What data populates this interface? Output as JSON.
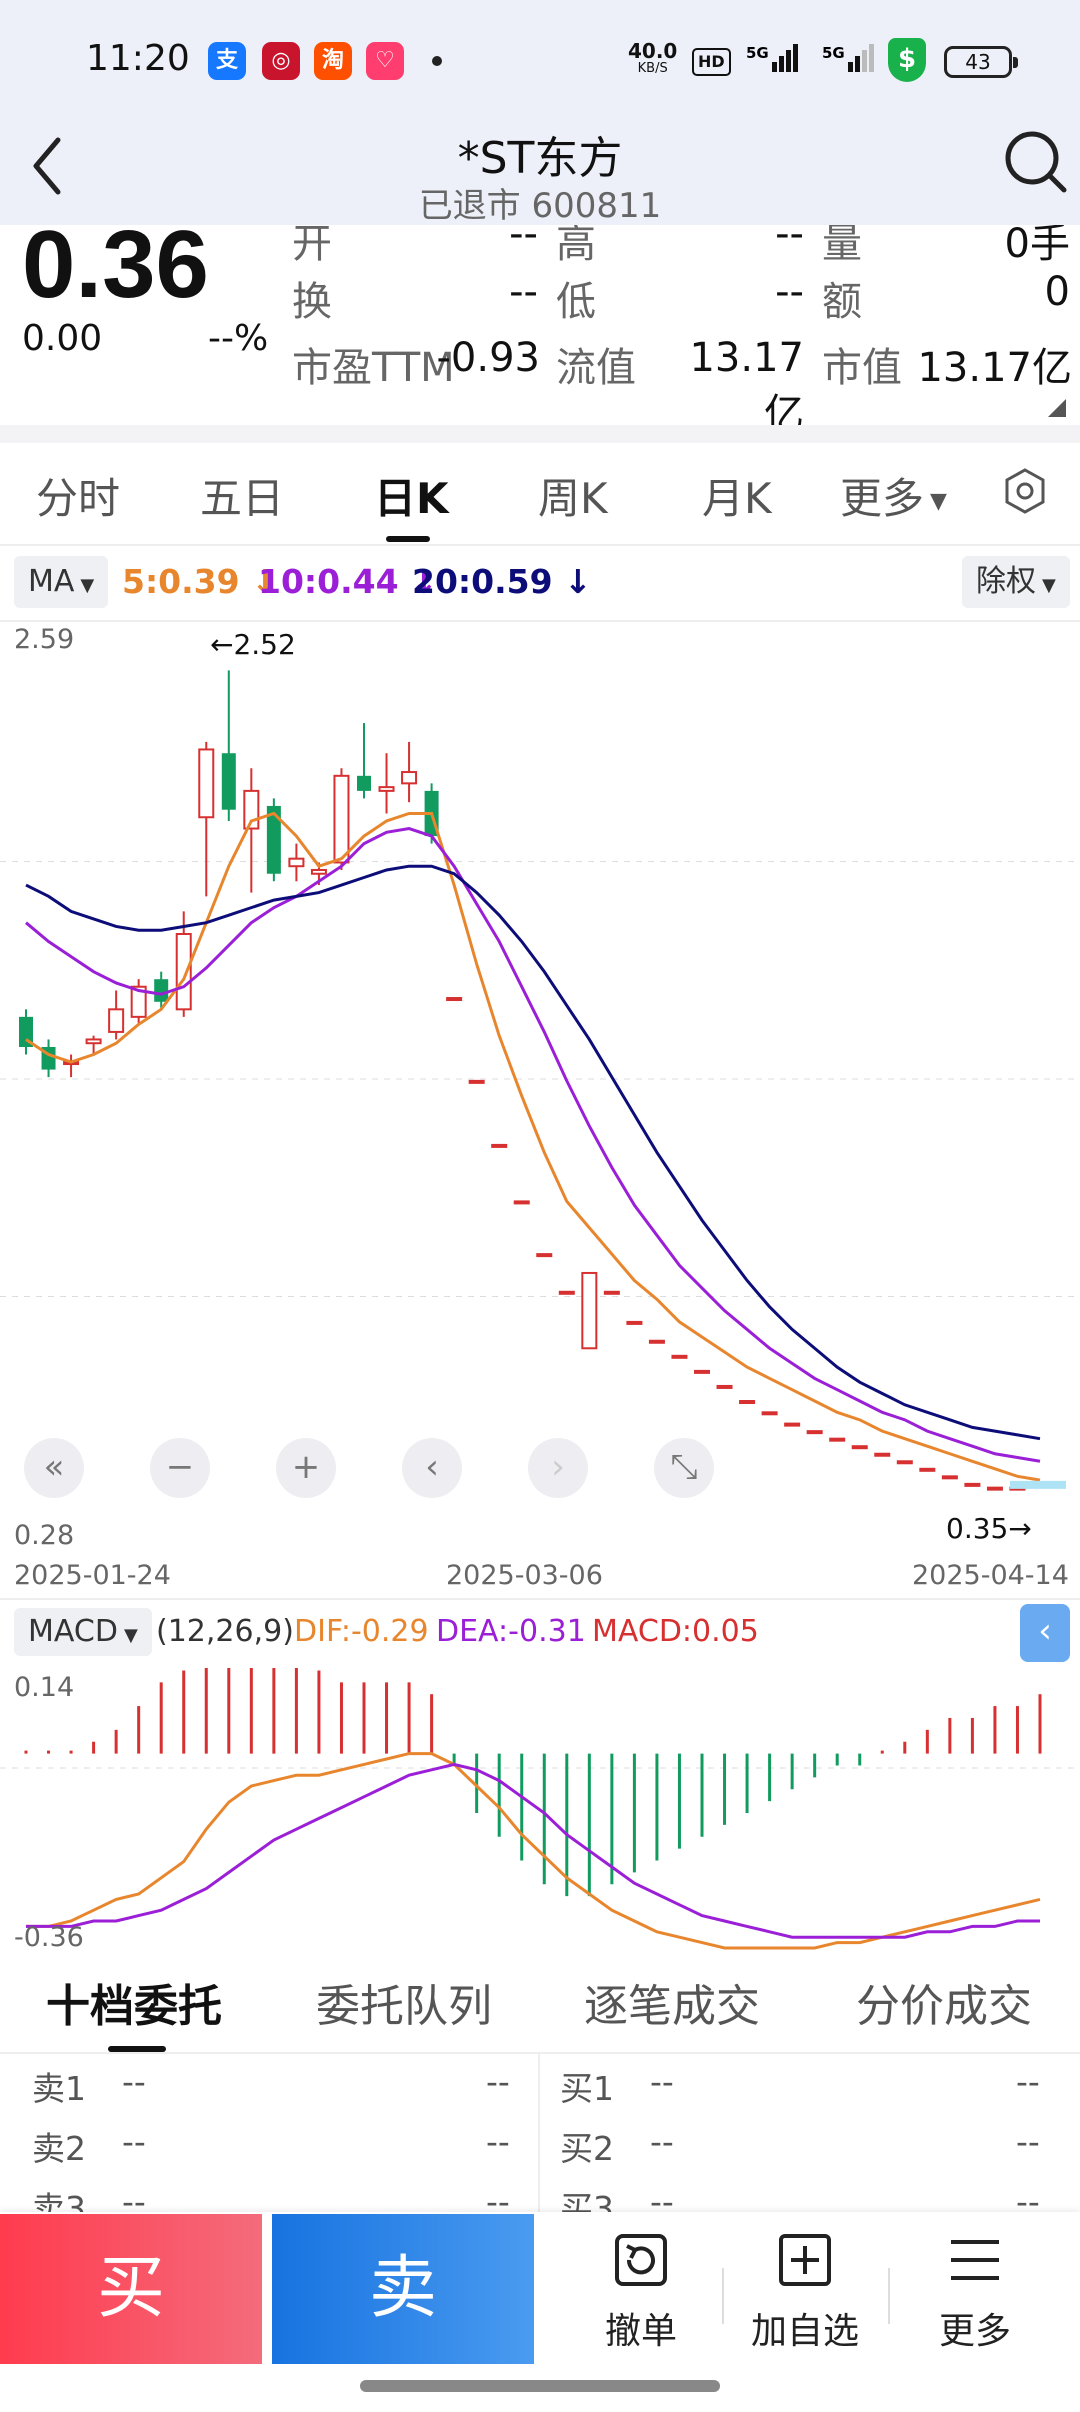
{
  "status_bar": {
    "time": "11:20",
    "net_speed": "40.0",
    "net_unit": "KB/S",
    "hd": "HD",
    "sig1": "⁵⁶",
    "sig2": "5G",
    "battery": "43",
    "app_icons": [
      {
        "name": "alipay-icon",
        "glyph": "支",
        "color": "#1677ff"
      },
      {
        "name": "bank-icon",
        "glyph": "◎",
        "color": "#c8152d"
      },
      {
        "name": "taobao-icon",
        "glyph": "淘",
        "color": "#ff5000"
      },
      {
        "name": "gift-icon",
        "glyph": "♡",
        "color": "#ff3d6e"
      }
    ]
  },
  "header": {
    "title": "*ST东方",
    "subtitle": "已退市 600811"
  },
  "quote": {
    "price": "0.36",
    "change": "0.00",
    "change_pct": "--%",
    "fields": [
      {
        "label": "开",
        "value": "--"
      },
      {
        "label": "高",
        "value": "--"
      },
      {
        "label": "量",
        "value": "0手"
      },
      {
        "label": "换",
        "value": "--"
      },
      {
        "label": "低",
        "value": "--"
      },
      {
        "label": "额",
        "value": "0"
      },
      {
        "label": "市盈TTM",
        "value": "-0.93"
      },
      {
        "label": "流值",
        "value": "13.17亿"
      },
      {
        "label": "市值",
        "value": "13.17亿"
      }
    ]
  },
  "tabs": [
    "分时",
    "五日",
    "日K",
    "周K",
    "月K",
    "更多"
  ],
  "active_tab": "日K",
  "ma_row": {
    "ma_label": "MA",
    "ma5": "5:0.39",
    "ma10": "10:0.44",
    "ma20": "20:0.59",
    "adjust": "除权"
  },
  "kline": {
    "y_top": "2.59",
    "y_bottom": "0.28",
    "high_marker": "←2.52",
    "low_marker": "0.35→",
    "dates": [
      "2025-01-24",
      "2025-03-06",
      "2025-04-14"
    ]
  },
  "macd": {
    "label": "MACD",
    "params": "(12,26,9)",
    "dif": "DIF:-0.29",
    "dea": "DEA:-0.31",
    "macd_val": "MACD:0.05",
    "y_top": "0.14",
    "y_bottom": "-0.36"
  },
  "orderbook": {
    "tabs": [
      "十档委托",
      "委托队列",
      "逐笔成交",
      "分价成交"
    ],
    "sell": [
      {
        "label": "卖1",
        "p": "--",
        "v": "--"
      },
      {
        "label": "卖2",
        "p": "--",
        "v": "--"
      },
      {
        "label": "卖3",
        "p": "--",
        "v": "--"
      }
    ],
    "buy": [
      {
        "label": "买1",
        "p": "--",
        "v": "--"
      },
      {
        "label": "买2",
        "p": "--",
        "v": "--"
      },
      {
        "label": "买3",
        "p": "--",
        "v": "--"
      }
    ]
  },
  "bottom_bar": {
    "buy": "买",
    "sell": "卖",
    "cancel": "撤单",
    "add_watch": "加自选",
    "more": "更多"
  },
  "chart_data": {
    "type": "candlestick",
    "y_range": [
      0.28,
      2.59
    ],
    "start_date": "2025-01-24",
    "mid_date": "2025-03-06",
    "end_date": "2025-04-14",
    "high": 2.52,
    "low": 0.35,
    "candles": [
      {
        "o": 1.6,
        "c": 1.52,
        "h": 1.62,
        "l": 1.5
      },
      {
        "o": 1.52,
        "c": 1.46,
        "h": 1.54,
        "l": 1.44
      },
      {
        "o": 1.48,
        "c": 1.48,
        "h": 1.5,
        "l": 1.44
      },
      {
        "o": 1.53,
        "c": 1.54,
        "h": 1.55,
        "l": 1.5
      },
      {
        "o": 1.56,
        "c": 1.62,
        "h": 1.67,
        "l": 1.54
      },
      {
        "o": 1.6,
        "c": 1.68,
        "h": 1.7,
        "l": 1.58
      },
      {
        "o": 1.7,
        "c": 1.64,
        "h": 1.72,
        "l": 1.62
      },
      {
        "o": 1.62,
        "c": 1.82,
        "h": 1.88,
        "l": 1.6
      },
      {
        "o": 2.13,
        "c": 2.31,
        "h": 2.33,
        "l": 1.92
      },
      {
        "o": 2.3,
        "c": 2.15,
        "h": 2.52,
        "l": 2.12
      },
      {
        "o": 2.1,
        "c": 2.2,
        "h": 2.26,
        "l": 1.93
      },
      {
        "o": 2.16,
        "c": 1.98,
        "h": 2.18,
        "l": 1.96
      },
      {
        "o": 2.0,
        "c": 2.02,
        "h": 2.06,
        "l": 1.96
      },
      {
        "o": 1.98,
        "c": 1.99,
        "h": 2.01,
        "l": 1.95
      },
      {
        "o": 2.01,
        "c": 2.24,
        "h": 2.26,
        "l": 1.99
      },
      {
        "o": 2.24,
        "c": 2.2,
        "h": 2.38,
        "l": 2.18
      },
      {
        "o": 2.2,
        "c": 2.21,
        "h": 2.3,
        "l": 2.14
      },
      {
        "o": 2.22,
        "c": 2.25,
        "h": 2.33,
        "l": 2.17
      },
      {
        "o": 2.2,
        "c": 2.08,
        "h": 2.22,
        "l": 2.06
      },
      {
        "o": 1.65,
        "c": 1.65,
        "h": 1.65,
        "l": 1.65
      },
      {
        "o": 1.43,
        "c": 1.43,
        "h": 1.43,
        "l": 1.43
      },
      {
        "o": 1.26,
        "c": 1.26,
        "h": 1.26,
        "l": 1.26
      },
      {
        "o": 1.11,
        "c": 1.11,
        "h": 1.11,
        "l": 1.11
      },
      {
        "o": 0.97,
        "c": 0.97,
        "h": 0.97,
        "l": 0.97
      },
      {
        "o": 0.87,
        "c": 0.87,
        "h": 0.87,
        "l": 0.87
      },
      {
        "o": 0.72,
        "c": 0.92,
        "h": 0.92,
        "l": 0.72
      },
      {
        "o": 0.87,
        "c": 0.87,
        "h": 0.87,
        "l": 0.87
      },
      {
        "o": 0.79,
        "c": 0.79,
        "h": 0.79,
        "l": 0.79
      },
      {
        "o": 0.74,
        "c": 0.74,
        "h": 0.74,
        "l": 0.74
      },
      {
        "o": 0.7,
        "c": 0.7,
        "h": 0.7,
        "l": 0.7
      },
      {
        "o": 0.66,
        "c": 0.66,
        "h": 0.66,
        "l": 0.66
      },
      {
        "o": 0.62,
        "c": 0.62,
        "h": 0.62,
        "l": 0.62
      },
      {
        "o": 0.58,
        "c": 0.58,
        "h": 0.58,
        "l": 0.58
      },
      {
        "o": 0.55,
        "c": 0.55,
        "h": 0.55,
        "l": 0.55
      },
      {
        "o": 0.52,
        "c": 0.52,
        "h": 0.52,
        "l": 0.52
      },
      {
        "o": 0.5,
        "c": 0.5,
        "h": 0.5,
        "l": 0.5
      },
      {
        "o": 0.48,
        "c": 0.48,
        "h": 0.48,
        "l": 0.48
      },
      {
        "o": 0.46,
        "c": 0.46,
        "h": 0.46,
        "l": 0.46
      },
      {
        "o": 0.44,
        "c": 0.44,
        "h": 0.44,
        "l": 0.44
      },
      {
        "o": 0.42,
        "c": 0.42,
        "h": 0.42,
        "l": 0.42
      },
      {
        "o": 0.4,
        "c": 0.4,
        "h": 0.4,
        "l": 0.4
      },
      {
        "o": 0.38,
        "c": 0.38,
        "h": 0.38,
        "l": 0.38
      },
      {
        "o": 0.36,
        "c": 0.36,
        "h": 0.36,
        "l": 0.36
      },
      {
        "o": 0.35,
        "c": 0.35,
        "h": 0.35,
        "l": 0.35
      },
      {
        "o": 0.35,
        "c": 0.35,
        "h": 0.35,
        "l": 0.35
      },
      {
        "o": 0.36,
        "c": 0.36,
        "h": 0.36,
        "l": 0.36
      }
    ],
    "series": [
      {
        "name": "MA5",
        "color": "#e8862e",
        "values": [
          1.54,
          1.5,
          1.48,
          1.5,
          1.53,
          1.58,
          1.62,
          1.7,
          1.85,
          2.0,
          2.12,
          2.14,
          2.08,
          2.0,
          2.02,
          2.08,
          2.12,
          2.14,
          2.14,
          1.95,
          1.74,
          1.55,
          1.39,
          1.24,
          1.11,
          1.04,
          0.97,
          0.9,
          0.85,
          0.79,
          0.75,
          0.71,
          0.67,
          0.64,
          0.61,
          0.58,
          0.55,
          0.53,
          0.5,
          0.48,
          0.46,
          0.44,
          0.42,
          0.4,
          0.38,
          0.37
        ]
      },
      {
        "name": "MA10",
        "color": "#9b1fd6",
        "values": [
          1.85,
          1.8,
          1.76,
          1.72,
          1.69,
          1.67,
          1.66,
          1.68,
          1.73,
          1.79,
          1.85,
          1.89,
          1.92,
          1.96,
          2.0,
          2.06,
          2.09,
          2.1,
          2.08,
          2.0,
          1.9,
          1.8,
          1.68,
          1.56,
          1.43,
          1.31,
          1.2,
          1.1,
          1.02,
          0.94,
          0.88,
          0.82,
          0.77,
          0.72,
          0.68,
          0.64,
          0.61,
          0.58,
          0.55,
          0.53,
          0.5,
          0.48,
          0.46,
          0.44,
          0.43,
          0.42
        ]
      },
      {
        "name": "MA20",
        "color": "#0d0d7a",
        "values": [
          1.95,
          1.92,
          1.88,
          1.86,
          1.84,
          1.83,
          1.83,
          1.84,
          1.85,
          1.87,
          1.89,
          1.91,
          1.92,
          1.93,
          1.95,
          1.97,
          1.99,
          2.0,
          2.0,
          1.98,
          1.93,
          1.87,
          1.8,
          1.72,
          1.63,
          1.54,
          1.44,
          1.34,
          1.24,
          1.15,
          1.06,
          0.98,
          0.9,
          0.83,
          0.77,
          0.72,
          0.67,
          0.63,
          0.6,
          0.57,
          0.55,
          0.53,
          0.51,
          0.5,
          0.49,
          0.48
        ]
      }
    ],
    "macd": {
      "dif": [
        -0.32,
        -0.32,
        -0.31,
        -0.29,
        -0.27,
        -0.26,
        -0.23,
        -0.2,
        -0.14,
        -0.09,
        -0.06,
        -0.05,
        -0.04,
        -0.04,
        -0.03,
        -0.02,
        -0.01,
        0.0,
        0.0,
        -0.02,
        -0.06,
        -0.1,
        -0.15,
        -0.19,
        -0.23,
        -0.26,
        -0.29,
        -0.31,
        -0.33,
        -0.34,
        -0.35,
        -0.36,
        -0.36,
        -0.36,
        -0.36,
        -0.36,
        -0.35,
        -0.35,
        -0.34,
        -0.33,
        -0.32,
        -0.31,
        -0.3,
        -0.29,
        -0.28,
        -0.27
      ],
      "dea": [
        -0.32,
        -0.32,
        -0.32,
        -0.31,
        -0.31,
        -0.3,
        -0.29,
        -0.27,
        -0.25,
        -0.22,
        -0.19,
        -0.16,
        -0.14,
        -0.12,
        -0.1,
        -0.08,
        -0.06,
        -0.04,
        -0.03,
        -0.02,
        -0.03,
        -0.05,
        -0.08,
        -0.11,
        -0.15,
        -0.18,
        -0.21,
        -0.24,
        -0.26,
        -0.28,
        -0.3,
        -0.31,
        -0.32,
        -0.33,
        -0.34,
        -0.34,
        -0.34,
        -0.34,
        -0.34,
        -0.34,
        -0.33,
        -0.33,
        -0.32,
        -0.32,
        -0.31,
        -0.31
      ],
      "hist": [
        0.0,
        0.0,
        0.0,
        0.01,
        0.02,
        0.04,
        0.06,
        0.07,
        0.09,
        0.1,
        0.1,
        0.09,
        0.08,
        0.07,
        0.06,
        0.06,
        0.06,
        0.06,
        0.05,
        -0.01,
        -0.05,
        -0.07,
        -0.09,
        -0.11,
        -0.12,
        -0.12,
        -0.11,
        -0.1,
        -0.09,
        -0.08,
        -0.07,
        -0.06,
        -0.05,
        -0.04,
        -0.03,
        -0.02,
        -0.01,
        -0.01,
        0.0,
        0.01,
        0.02,
        0.03,
        0.03,
        0.04,
        0.04,
        0.05
      ],
      "y_range": [
        -0.36,
        0.14
      ]
    }
  }
}
